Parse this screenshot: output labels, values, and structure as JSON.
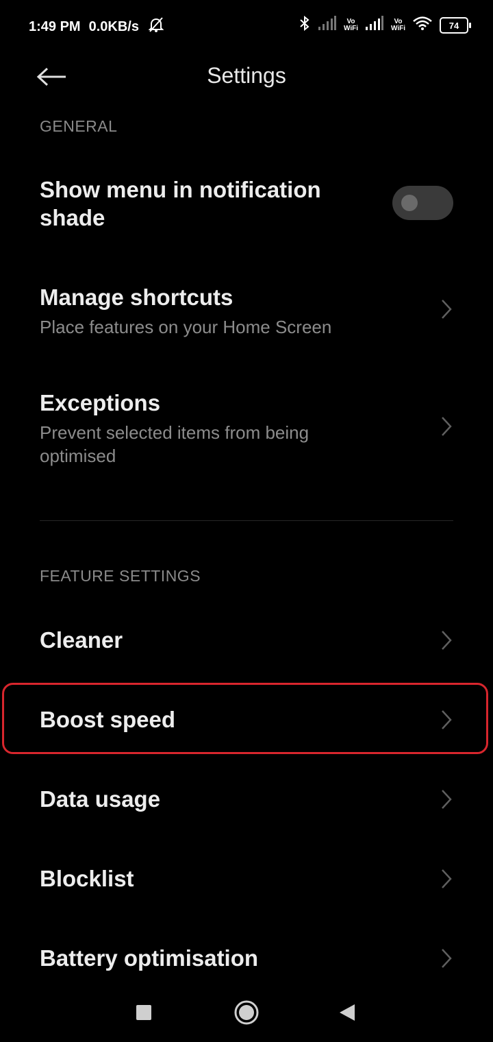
{
  "status_bar": {
    "time": "1:49 PM",
    "speed": "0.0KB/s",
    "vowifi_1": [
      "Vo",
      "WiFi"
    ],
    "vowifi_2": [
      "Vo",
      "WiFi"
    ],
    "battery_level": "74"
  },
  "header": {
    "title": "Settings"
  },
  "sections": {
    "general": "GENERAL",
    "feature_settings": "FEATURE SETTINGS"
  },
  "general": {
    "notification_menu": {
      "title": "Show menu in notification shade",
      "enabled": false
    },
    "manage_shortcuts": {
      "title": "Manage shortcuts",
      "subtitle": "Place features on your Home Screen"
    },
    "exceptions": {
      "title": "Exceptions",
      "subtitle": "Prevent selected items from being optimised"
    }
  },
  "features": {
    "cleaner": "Cleaner",
    "boost_speed": "Boost speed",
    "data_usage": "Data usage",
    "blocklist": "Blocklist",
    "battery_optimisation": "Battery optimisation"
  },
  "colors": {
    "background": "#000000",
    "highlight": "#d8262d",
    "secondary_text": "#8c8c8c"
  }
}
